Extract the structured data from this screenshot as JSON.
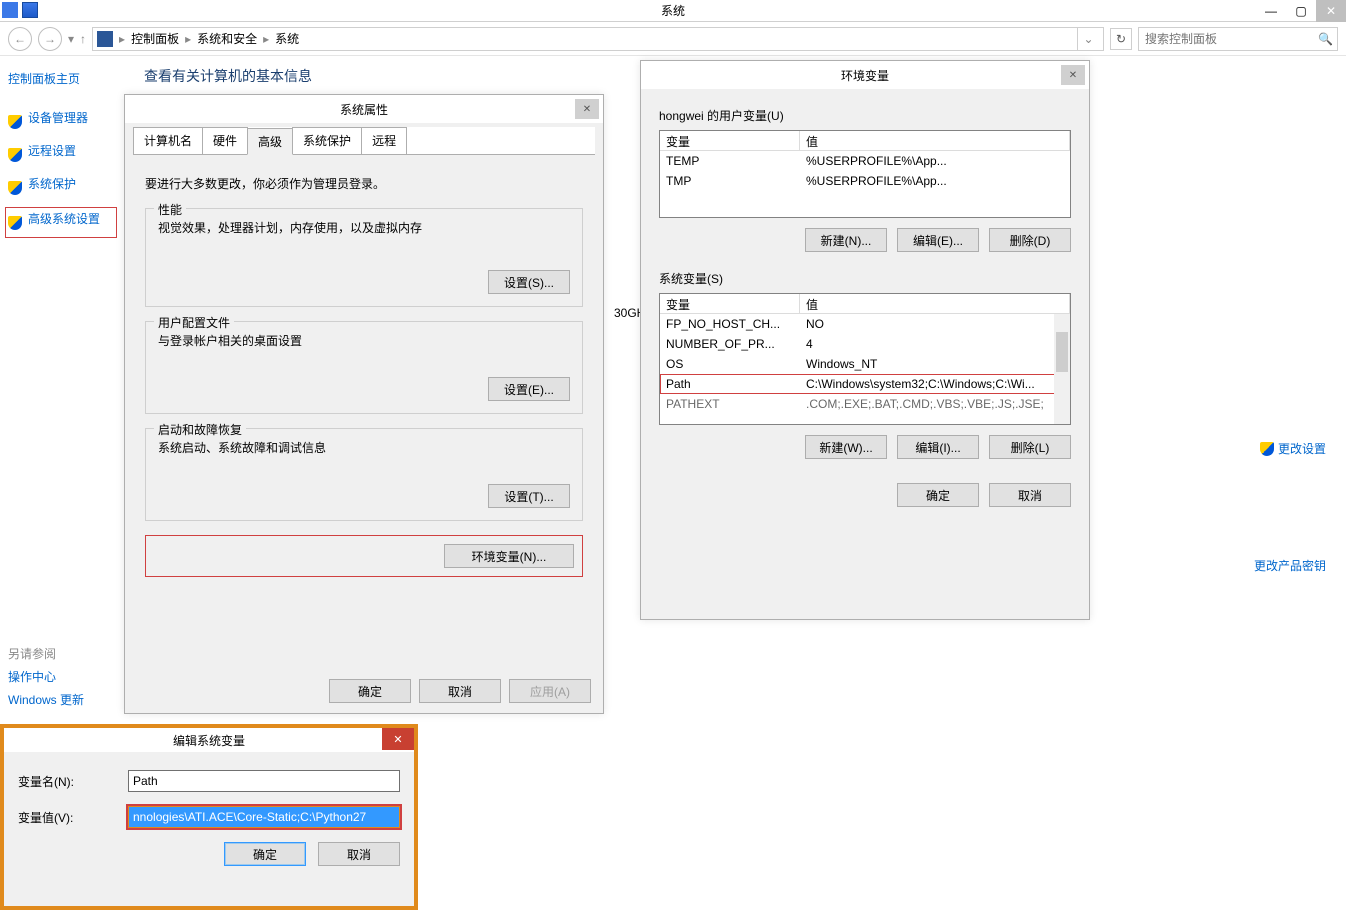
{
  "window": {
    "title": "系统",
    "minimize": "—",
    "maximize": "▢",
    "close": "✕"
  },
  "nav": {
    "back_glyph": "←",
    "fwd_glyph": "→",
    "up_glyph": "▾",
    "menu_glyph": "▾",
    "crumbs": [
      "控制面板",
      "系统和安全",
      "系统"
    ],
    "crumb_sep": "▸",
    "dropdown": "⌄",
    "refresh": "↻",
    "search_placeholder": "搜索控制面板",
    "search_icon": "🔍"
  },
  "sidebar": {
    "home": "控制面板主页",
    "items": [
      {
        "label": "设备管理器"
      },
      {
        "label": "远程设置"
      },
      {
        "label": "系统保护"
      },
      {
        "label": "高级系统设置"
      }
    ]
  },
  "main": {
    "heading": "查看有关计算机的基本信息"
  },
  "see_also": {
    "header": "另请参阅",
    "links": [
      "操作中心",
      "Windows 更新"
    ]
  },
  "stray_text": "30GH",
  "right_links": {
    "change_settings": "更改设置",
    "change_key": "更改产品密钥"
  },
  "sysprops": {
    "title": "系统属性",
    "close": "✕",
    "tabs": [
      "计算机名",
      "硬件",
      "高级",
      "系统保护",
      "远程"
    ],
    "active_tab": 2,
    "note": "要进行大多数更改，你必须作为管理员登录。",
    "groups": {
      "perf": {
        "title": "性能",
        "desc": "视觉效果，处理器计划，内存使用，以及虚拟内存",
        "btn": "设置(S)..."
      },
      "profiles": {
        "title": "用户配置文件",
        "desc": "与登录帐户相关的桌面设置",
        "btn": "设置(E)..."
      },
      "startup": {
        "title": "启动和故障恢复",
        "desc": "系统启动、系统故障和调试信息",
        "btn": "设置(T)..."
      }
    },
    "env_btn": "环境变量(N)...",
    "ok": "确定",
    "cancel": "取消",
    "apply": "应用(A)"
  },
  "envdlg": {
    "title": "环境变量",
    "close": "✕",
    "user_section": "hongwei 的用户变量(U)",
    "sys_section": "系统变量(S)",
    "col_var": "变量",
    "col_val": "值",
    "user_vars": [
      {
        "name": "TEMP",
        "value": "%USERPROFILE%\\App..."
      },
      {
        "name": "TMP",
        "value": "%USERPROFILE%\\App..."
      }
    ],
    "sys_vars": [
      {
        "name": "FP_NO_HOST_CH...",
        "value": "NO"
      },
      {
        "name": "NUMBER_OF_PR...",
        "value": "4"
      },
      {
        "name": "OS",
        "value": "Windows_NT"
      },
      {
        "name": "Path",
        "value": "C:\\Windows\\system32;C:\\Windows;C:\\Wi..."
      },
      {
        "name": "PATHEXT",
        "value": ".COM;.EXE;.BAT;.CMD;.VBS;.VBE;.JS;.JSE;"
      }
    ],
    "btns_user": {
      "new": "新建(N)...",
      "edit": "编辑(E)...",
      "del": "删除(D)"
    },
    "btns_sys": {
      "new": "新建(W)...",
      "edit": "编辑(I)...",
      "del": "删除(L)"
    },
    "ok": "确定",
    "cancel": "取消"
  },
  "editdlg": {
    "title": "编辑系统变量",
    "close": "✕",
    "name_label": "变量名(N):",
    "value_label": "变量值(V):",
    "name_value": "Path",
    "value_value": "nnologies\\ATI.ACE\\Core-Static;C:\\Python27",
    "ok": "确定",
    "cancel": "取消"
  }
}
